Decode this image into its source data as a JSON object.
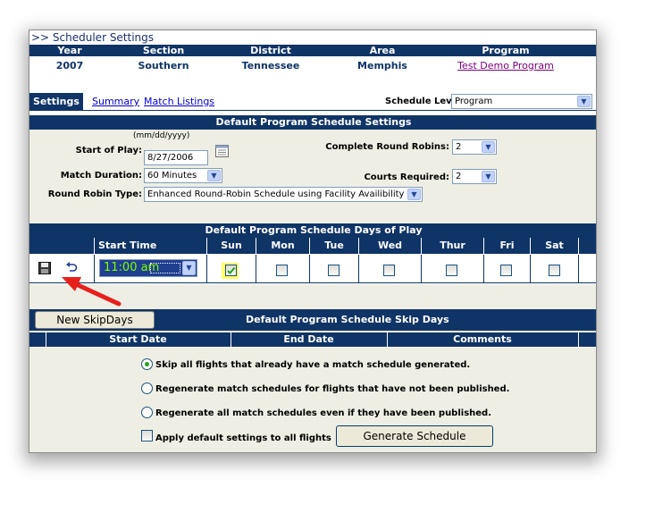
{
  "page": {
    "title": ">> Scheduler Settings"
  },
  "header": {
    "columns": [
      "Year",
      "Section",
      "District",
      "Area",
      "Program"
    ],
    "values": {
      "year": "2007",
      "section": "Southern",
      "district": "Tennessee",
      "area": "Memphis",
      "program": "Test Demo Program"
    }
  },
  "tabs": [
    {
      "label": "Settings",
      "active": true
    },
    {
      "label": "Summary",
      "active": false
    },
    {
      "label": "Match Listings",
      "active": false
    }
  ],
  "schedule_level": {
    "label": "Schedule Level:",
    "value": "Program"
  },
  "settings": {
    "title": "Default Program Schedule Settings",
    "start_of_play": {
      "label": "Start of Play:",
      "hint": "(mm/dd/yyyy)",
      "value": "8/27/2006"
    },
    "match_duration": {
      "label": "Match Duration:",
      "value": "60 Minutes"
    },
    "round_robin_type": {
      "label": "Round Robin Type:",
      "value": "Enhanced Round-Robin Schedule using Facility Availibility"
    },
    "complete_round_robins": {
      "label": "Complete Round Robins:",
      "value": "2"
    },
    "courts_required": {
      "label": "Courts Required:",
      "value": "2"
    }
  },
  "days": {
    "title": "Default Program Schedule Days of Play",
    "start_time_header": "Start Time",
    "start_time_value": "11:00 am",
    "day_headers": [
      "Sun",
      "Mon",
      "Tue",
      "Wed",
      "Thur",
      "Fri",
      "Sat"
    ],
    "checked": [
      true,
      false,
      false,
      false,
      false,
      false,
      false
    ]
  },
  "skip_days": {
    "new_button": "New SkipDays",
    "title": "Default Program Schedule Skip Days",
    "columns": [
      "Start Date",
      "End Date",
      "Comments"
    ]
  },
  "options": [
    {
      "label": "Skip all flights that already have a match schedule generated.",
      "selected": true
    },
    {
      "label": "Regenerate match schedules for flights that have not been published.",
      "selected": false
    },
    {
      "label": "Regenerate all match schedules even if they have been published.",
      "selected": false
    }
  ],
  "apply_default": {
    "label": "Apply default settings to all flights",
    "checked": false
  },
  "generate_button": "Generate Schedule",
  "icons": {
    "save": "save-icon",
    "undo": "undo-icon",
    "calendar": "calendar-icon",
    "annotation": "red-arrow"
  },
  "colors": {
    "navy": "#0f3466",
    "panel": "#eeeee4",
    "highlight": "#ffff66",
    "time_field": "#1f3f8f",
    "time_text": "#7fff00",
    "arrow": "#e8201c"
  }
}
